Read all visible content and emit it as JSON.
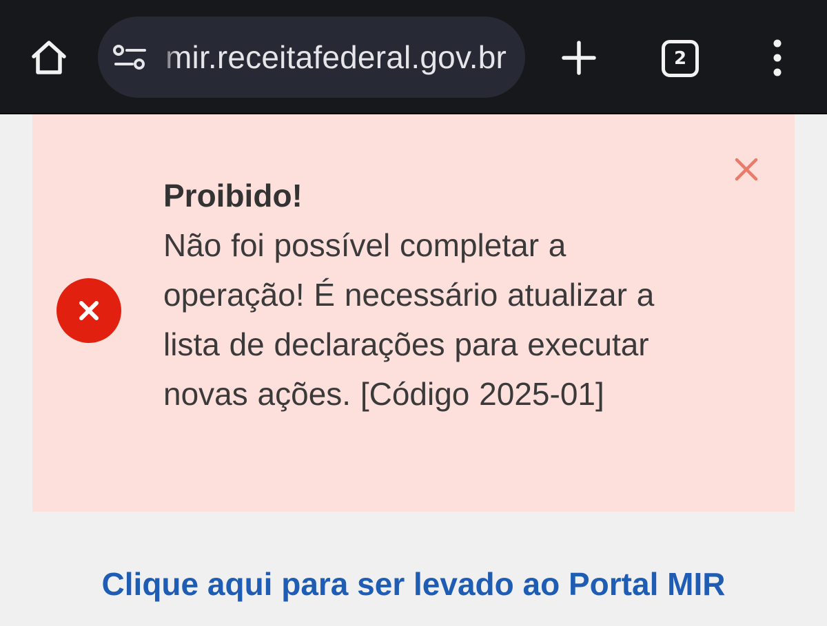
{
  "browser": {
    "url": "mir.receitafederal.gov.br",
    "tab_count": "2",
    "icons": {
      "home": "home-icon",
      "site_settings": "site-settings-icon",
      "new_tab": "plus-icon",
      "menu": "more-vertical-icon"
    }
  },
  "alert": {
    "title": "Proibido!",
    "message": "Não foi possível completar a operação! É necessário atualizar a lista de declarações para executar novas ações. [Código 2025-01]",
    "icon": "error-x-icon",
    "close_icon": "close-icon",
    "colors": {
      "background": "#fddfdb",
      "icon": "#e2200f",
      "close": "#ea7a6a"
    }
  },
  "link": {
    "text": "Clique aqui para ser levado ao Portal MIR",
    "color": "#1f5db5"
  }
}
